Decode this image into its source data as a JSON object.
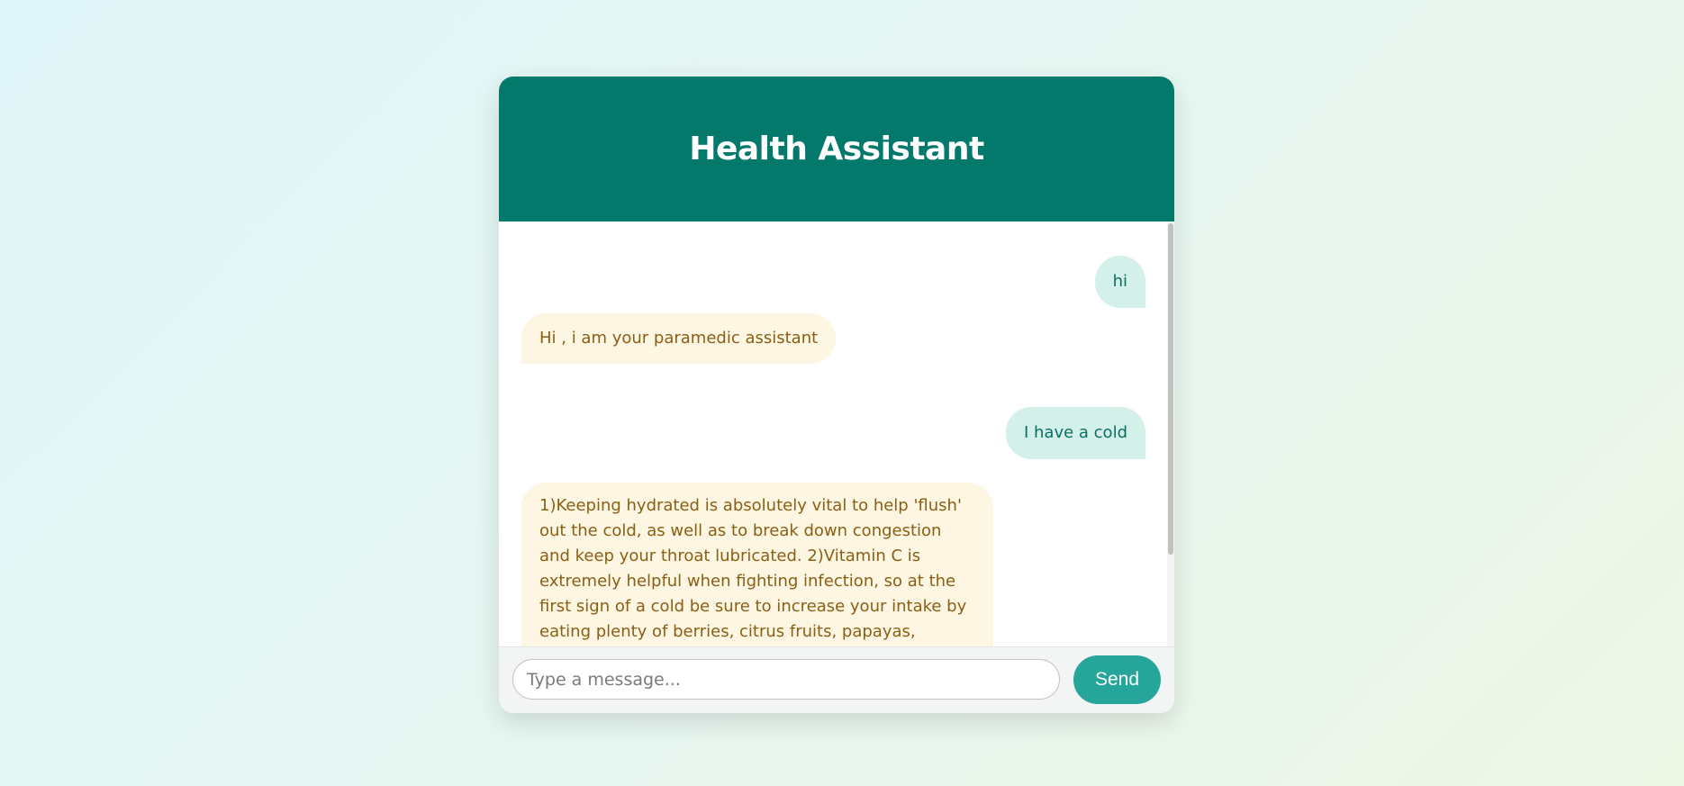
{
  "header": {
    "title": "Health Assistant"
  },
  "messages": [
    {
      "sender": "user",
      "text": "hi"
    },
    {
      "sender": "bot",
      "text": "Hi , i am your paramedic assistant"
    },
    {
      "sender": "user",
      "text": "I have a cold"
    },
    {
      "sender": "bot",
      "text": "1)Keeping hydrated is absolutely vital to help 'flush' out the cold, as well as to break down congestion and keep your throat lubricated. 2)Vitamin C is extremely helpful when fighting infection, so at the first sign of a cold be sure to increase your intake by eating plenty of berries, citrus fruits, papayas, broccoli and red peppers which will"
    }
  ],
  "input": {
    "placeholder": "Type a message...",
    "value": ""
  },
  "send_button": {
    "label": "Send"
  },
  "colors": {
    "header_bg": "#02796b",
    "user_bubble_bg": "#d3f1ea",
    "user_text": "#0b6e63",
    "bot_bubble_bg": "#fdf6e3",
    "bot_text": "#8b5e12",
    "send_button_bg": "#26a69a"
  }
}
